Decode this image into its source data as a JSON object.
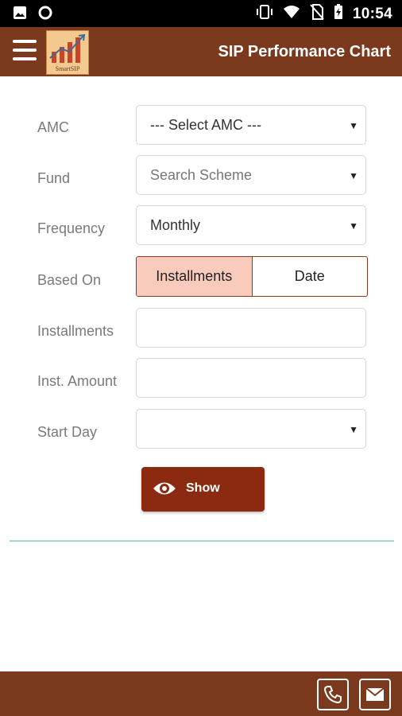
{
  "status_bar": {
    "time": "10:54",
    "icons": [
      "image-icon",
      "circle-icon",
      "vibrate-icon",
      "wifi-icon",
      "no-sim-icon",
      "battery-charging-icon"
    ]
  },
  "app_bar": {
    "title": "SIP Performance Chart",
    "logo_text": "SmartSIP",
    "menu_icon": "hamburger-menu-icon"
  },
  "form": {
    "amc": {
      "label": "AMC",
      "value": "--- Select AMC ---"
    },
    "fund": {
      "label": "Fund",
      "placeholder": "Search Scheme"
    },
    "frequency": {
      "label": "Frequency",
      "value": "Monthly"
    },
    "based_on": {
      "label": "Based On",
      "options": [
        "Installments",
        "Date"
      ],
      "selected": "Installments"
    },
    "installments": {
      "label": "Installments",
      "value": ""
    },
    "inst_amount": {
      "label": "Inst. Amount",
      "value": ""
    },
    "start_day": {
      "label": "Start Day",
      "value": ""
    }
  },
  "actions": {
    "show_label": "Show",
    "show_icon": "eye-icon"
  },
  "bottom_bar": {
    "icons": [
      "phone-icon",
      "mail-icon"
    ]
  },
  "colors": {
    "primary": "#7b3a1e",
    "button": "#8b2a10",
    "toggle_active": "#f9cbbd",
    "divider": "#a8d3cf"
  }
}
